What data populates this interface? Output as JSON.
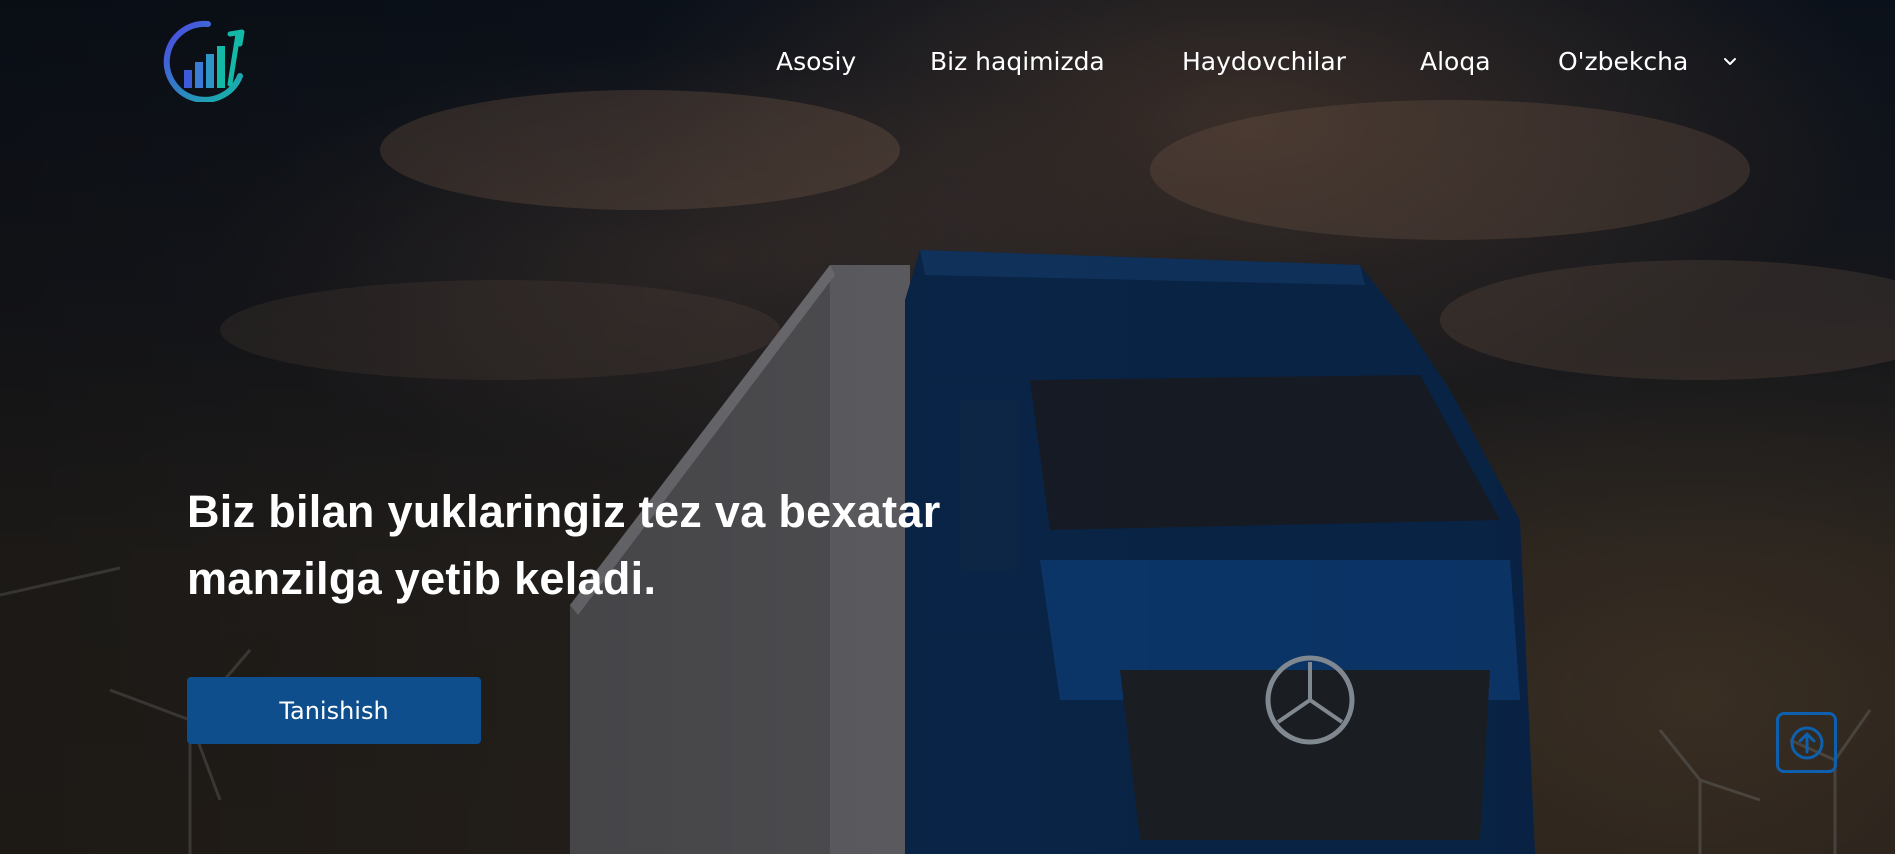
{
  "nav": {
    "items": [
      {
        "label": "Asosiy"
      },
      {
        "label": "Biz haqimizda"
      },
      {
        "label": "Haydovchilar"
      },
      {
        "label": "Aloqa"
      }
    ],
    "language": {
      "label": "O'zbekcha",
      "icon": "chevron-down-icon"
    }
  },
  "logo": {
    "icon": "growth-chart-logo"
  },
  "hero": {
    "headline_line1": "Biz bilan yuklaringiz tez va bexatar",
    "headline_line2": "manzilga yetib keladi.",
    "cta_label": "Tanishish",
    "background": "truck-photo"
  },
  "scroll_top": {
    "icon": "arrow-up-icon"
  },
  "colors": {
    "accent": "#0e4e8c",
    "scroll_border": "#0e5fae",
    "text": "#ffffff"
  }
}
